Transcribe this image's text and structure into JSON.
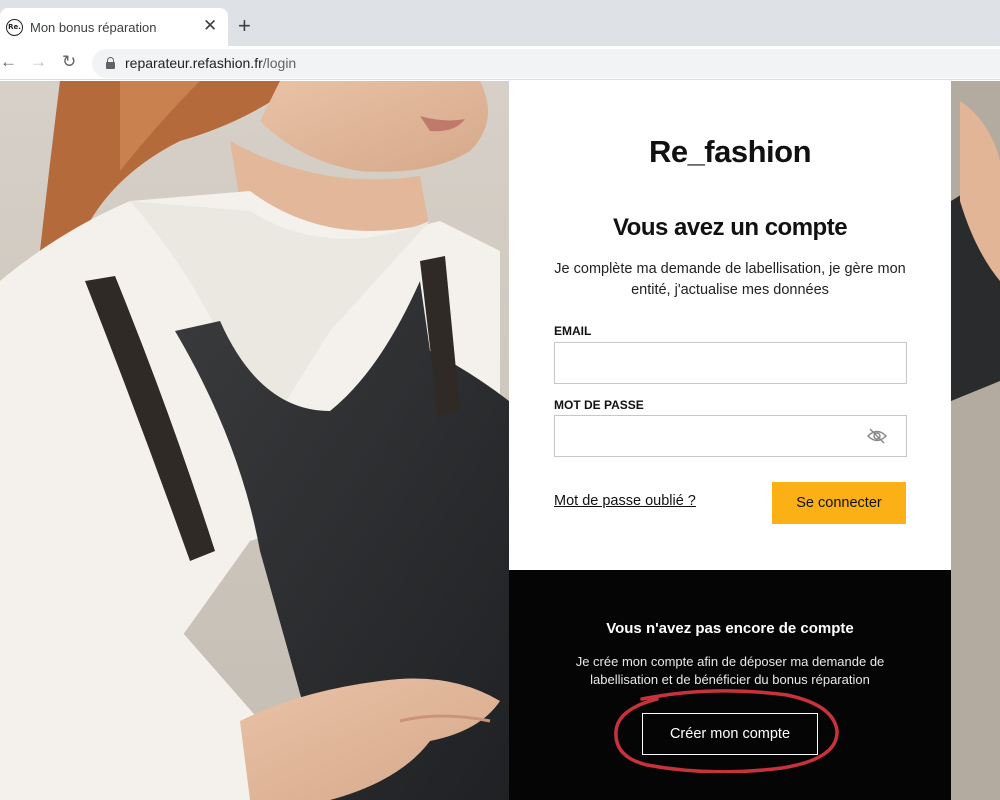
{
  "browser": {
    "tab": {
      "favicon_text": "Re.",
      "title": "Mon bonus réparation"
    },
    "url": {
      "domain": "reparateur.refashion.fr",
      "path": "/login"
    }
  },
  "login": {
    "logo": "Re_fashion",
    "title": "Vous avez un compte",
    "subtitle": "Je complète ma demande de labellisation, je gère mon entité, j'actualise mes données",
    "email_label": "EMAIL",
    "email_value": "",
    "password_label": "MOT DE PASSE",
    "password_value": "",
    "forgot_link": "Mot de passe oublié ?",
    "login_button": "Se connecter"
  },
  "signup": {
    "title": "Vous n'avez pas encore de compte",
    "subtitle": "Je crée mon compte afin de déposer ma demande de labellisation et de bénéficier du bonus réparation",
    "create_button": "Créer mon compte"
  },
  "colors": {
    "accent": "#fbb116",
    "annotation": "#c8323c",
    "dark_panel": "#050505"
  }
}
